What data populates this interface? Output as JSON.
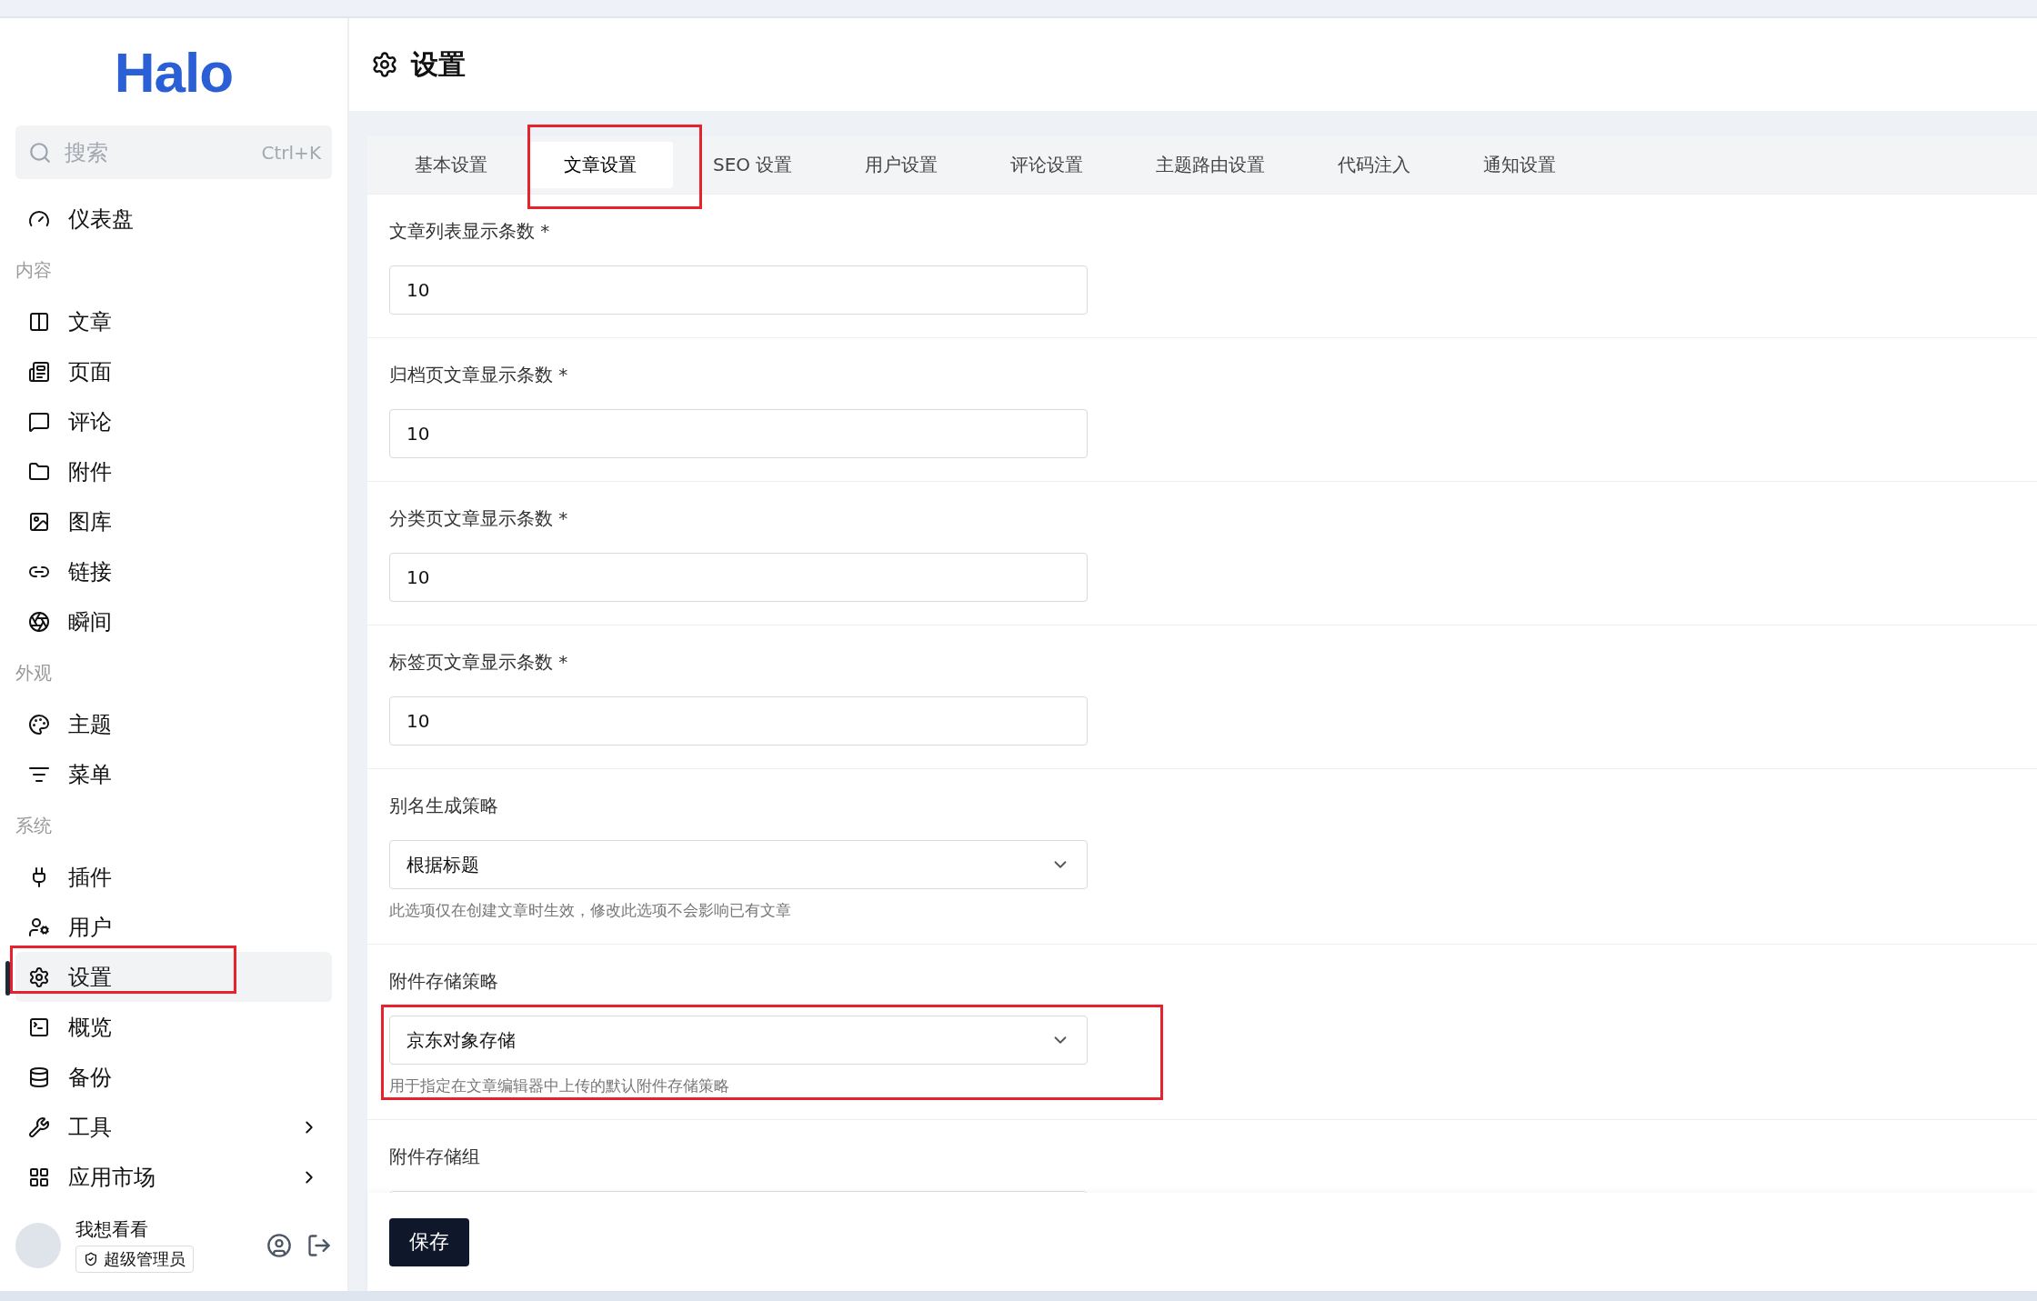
{
  "sidebar": {
    "logo": "Halo",
    "search": {
      "placeholder": "搜索",
      "shortcut": "Ctrl+K"
    },
    "groups": [
      {
        "items": [
          {
            "label": "仪表盘",
            "selected": false,
            "has_submenu": false,
            "highlighted": false
          }
        ]
      },
      {
        "title": "内容",
        "items": [
          {
            "label": "文章",
            "selected": false,
            "has_submenu": false,
            "highlighted": false
          },
          {
            "label": "页面",
            "selected": false,
            "has_submenu": false,
            "highlighted": false
          },
          {
            "label": "评论",
            "selected": false,
            "has_submenu": false,
            "highlighted": false
          },
          {
            "label": "附件",
            "selected": false,
            "has_submenu": false,
            "highlighted": false
          },
          {
            "label": "图库",
            "selected": false,
            "has_submenu": false,
            "highlighted": false
          },
          {
            "label": "链接",
            "selected": false,
            "has_submenu": false,
            "highlighted": false
          },
          {
            "label": "瞬间",
            "selected": false,
            "has_submenu": false,
            "highlighted": false
          }
        ]
      },
      {
        "title": "外观",
        "items": [
          {
            "label": "主题",
            "selected": false,
            "has_submenu": false,
            "highlighted": false
          },
          {
            "label": "菜单",
            "selected": false,
            "has_submenu": false,
            "highlighted": false
          }
        ]
      },
      {
        "title": "系统",
        "items": [
          {
            "label": "插件",
            "selected": false,
            "has_submenu": false,
            "highlighted": false
          },
          {
            "label": "用户",
            "selected": false,
            "has_submenu": false,
            "highlighted": false
          },
          {
            "label": "设置",
            "selected": true,
            "has_submenu": false,
            "highlighted": true
          },
          {
            "label": "概览",
            "selected": false,
            "has_submenu": false,
            "highlighted": false
          },
          {
            "label": "备份",
            "selected": false,
            "has_submenu": false,
            "highlighted": false
          },
          {
            "label": "工具",
            "selected": false,
            "has_submenu": true,
            "highlighted": false
          },
          {
            "label": "应用市场",
            "selected": false,
            "has_submenu": true,
            "highlighted": false
          }
        ]
      }
    ],
    "user": {
      "name": "我想看看",
      "role": "超级管理员"
    }
  },
  "page": {
    "title": "设置"
  },
  "tabs": [
    {
      "label": "基本设置",
      "selected": false,
      "highlighted": false
    },
    {
      "label": "文章设置",
      "selected": true,
      "highlighted": true
    },
    {
      "label": "SEO 设置",
      "selected": false,
      "highlighted": false
    },
    {
      "label": "用户设置",
      "selected": false,
      "highlighted": false
    },
    {
      "label": "评论设置",
      "selected": false,
      "highlighted": false
    },
    {
      "label": "主题路由设置",
      "selected": false,
      "highlighted": false
    },
    {
      "label": "代码注入",
      "selected": false,
      "highlighted": false
    },
    {
      "label": "通知设置",
      "selected": false,
      "highlighted": false
    }
  ],
  "fields": [
    {
      "kind": "input",
      "label": "文章列表显示条数 *",
      "value": "10",
      "highlighted": false
    },
    {
      "kind": "input",
      "label": "归档页文章显示条数 *",
      "value": "10",
      "highlighted": false
    },
    {
      "kind": "input",
      "label": "分类页文章显示条数 *",
      "value": "10",
      "highlighted": false
    },
    {
      "kind": "input",
      "label": "标签页文章显示条数 *",
      "value": "10",
      "highlighted": false
    },
    {
      "kind": "select",
      "label": "别名生成策略",
      "value": "根据标题",
      "hint": "此选项仅在创建文章时生效，修改此选项不会影响已有文章",
      "highlighted": false
    },
    {
      "kind": "select",
      "label": "附件存储策略",
      "value": "京东对象存储",
      "hint": "用于指定在文章编辑器中上传的默认附件存储策略",
      "highlighted": true
    },
    {
      "kind": "select",
      "label": "附件存储组",
      "highlighted": false
    }
  ],
  "save_button": "保存"
}
